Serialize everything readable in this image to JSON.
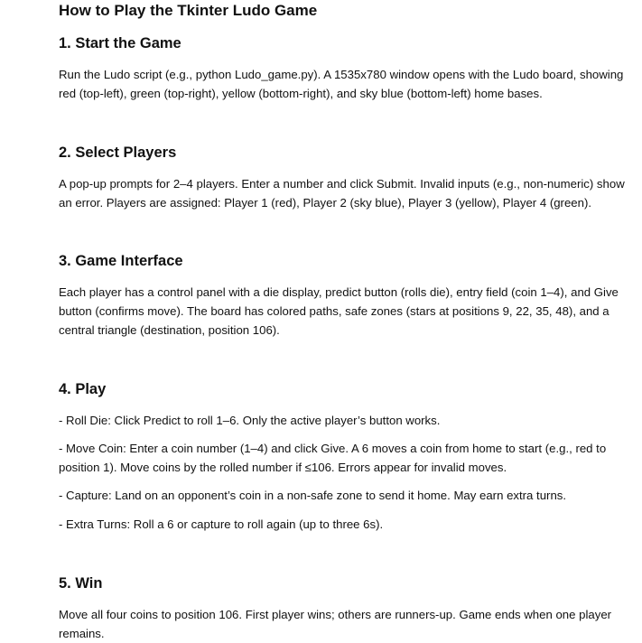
{
  "document": {
    "title": "How to Play the Tkinter Ludo Game",
    "sections": [
      {
        "heading": "1. Start the Game",
        "paragraphs": [
          "Run the Ludo script (e.g., python Ludo_game.py). A 1535x780 window opens with the Ludo board, showing red (top-left), green (top-right), yellow (bottom-right), and sky blue (bottom-left) home bases."
        ]
      },
      {
        "heading": "2. Select Players",
        "paragraphs": [
          "A pop-up prompts for 2–4 players. Enter a number and click Submit. Invalid inputs (e.g., non-numeric) show an error. Players are assigned: Player 1 (red), Player 2 (sky blue), Player 3 (yellow), Player 4 (green)."
        ]
      },
      {
        "heading": "3. Game Interface",
        "paragraphs": [
          "Each player has a control panel with a die display, predict button (rolls die), entry field (coin 1–4), and Give button (confirms move). The board has colored paths, safe zones (stars at positions 9, 22, 35, 48), and a central triangle (destination, position 106)."
        ]
      },
      {
        "heading": "4. Play",
        "paragraphs": [
          "- Roll Die: Click Predict to roll 1–6. Only the active player’s button works.",
          "- Move Coin: Enter a coin number (1–4) and click Give. A 6 moves a coin from home to start (e.g., red to position 1). Move coins by the rolled number if ≤106. Errors appear for invalid moves.",
          "- Capture: Land on an opponent’s coin in a non-safe zone to send it home. May earn extra turns.",
          "- Extra Turns: Roll a 6 or capture to roll again (up to three 6s)."
        ]
      },
      {
        "heading": "5. Win",
        "paragraphs": [
          "Move all four coins to position 106. First player wins; others are runners-up. Game ends when one player remains."
        ]
      }
    ]
  }
}
